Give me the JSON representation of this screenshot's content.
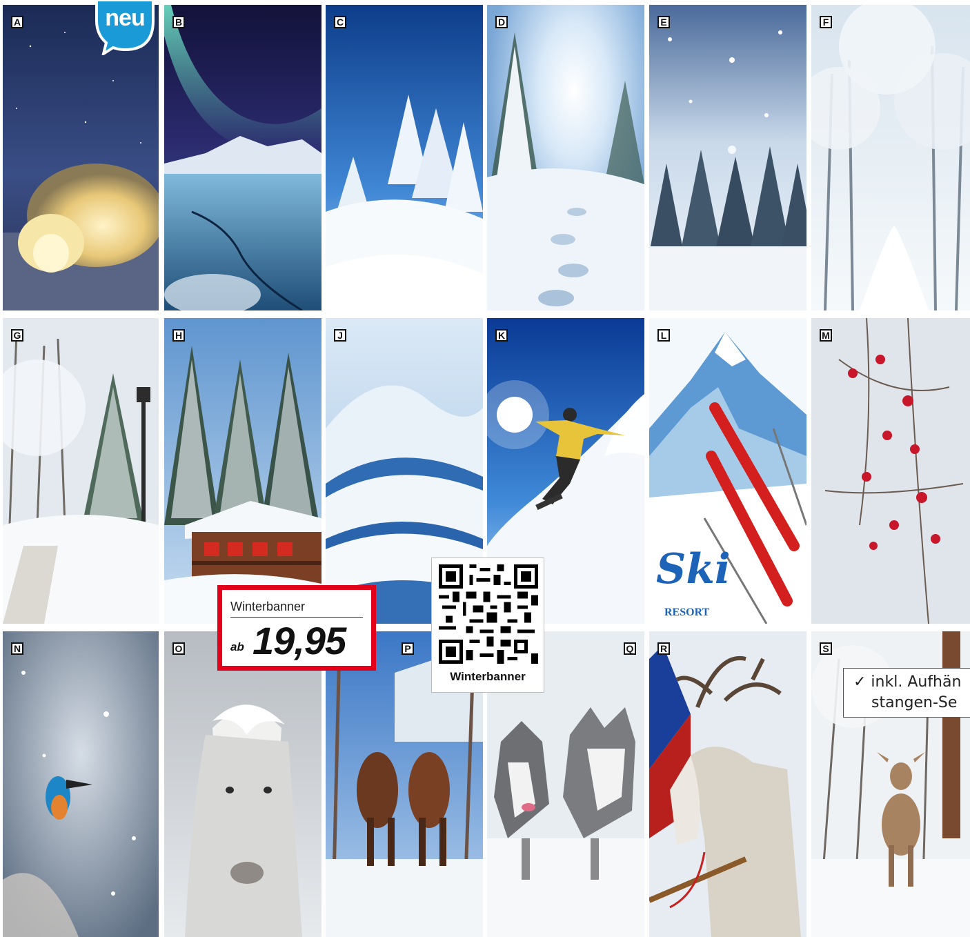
{
  "badge": {
    "text": "neu",
    "color": "#1a9ad6"
  },
  "tiles": [
    {
      "letter": "A",
      "subject": "igloo at night"
    },
    {
      "letter": "B",
      "subject": "northern lights over frozen lake"
    },
    {
      "letter": "C",
      "subject": "snowy pine trees under blue sky"
    },
    {
      "letter": "D",
      "subject": "footprints in snow with sun"
    },
    {
      "letter": "E",
      "subject": "snowfall over forest"
    },
    {
      "letter": "F",
      "subject": "frosted forest path"
    },
    {
      "letter": "G",
      "subject": "snowy park with lantern"
    },
    {
      "letter": "H",
      "subject": "wooden chalet with red shutters"
    },
    {
      "letter": "J",
      "subject": "snowy hills"
    },
    {
      "letter": "K",
      "subject": "snowboarder"
    },
    {
      "letter": "L",
      "subject": "ski resort poster"
    },
    {
      "letter": "M",
      "subject": "red berries in snow"
    },
    {
      "letter": "N",
      "subject": "kingfisher in snowfall"
    },
    {
      "letter": "O",
      "subject": "white horse"
    },
    {
      "letter": "P",
      "subject": "horse-drawn sleigh"
    },
    {
      "letter": "Q",
      "subject": "husky dogs"
    },
    {
      "letter": "R",
      "subject": "reindeer with sleigh"
    },
    {
      "letter": "S",
      "subject": "deer in snowy forest"
    }
  ],
  "ski_poster": {
    "logo_text": "Ski",
    "sub_text": "RESORT"
  },
  "price": {
    "title": "Winterbanner",
    "prefix": "ab",
    "value": "19,95",
    "border_color": "#e2001a"
  },
  "qr": {
    "caption": "Winterbanner"
  },
  "feature": {
    "line1": "✓ inkl. Aufhän",
    "line2": "stangen-Se"
  }
}
